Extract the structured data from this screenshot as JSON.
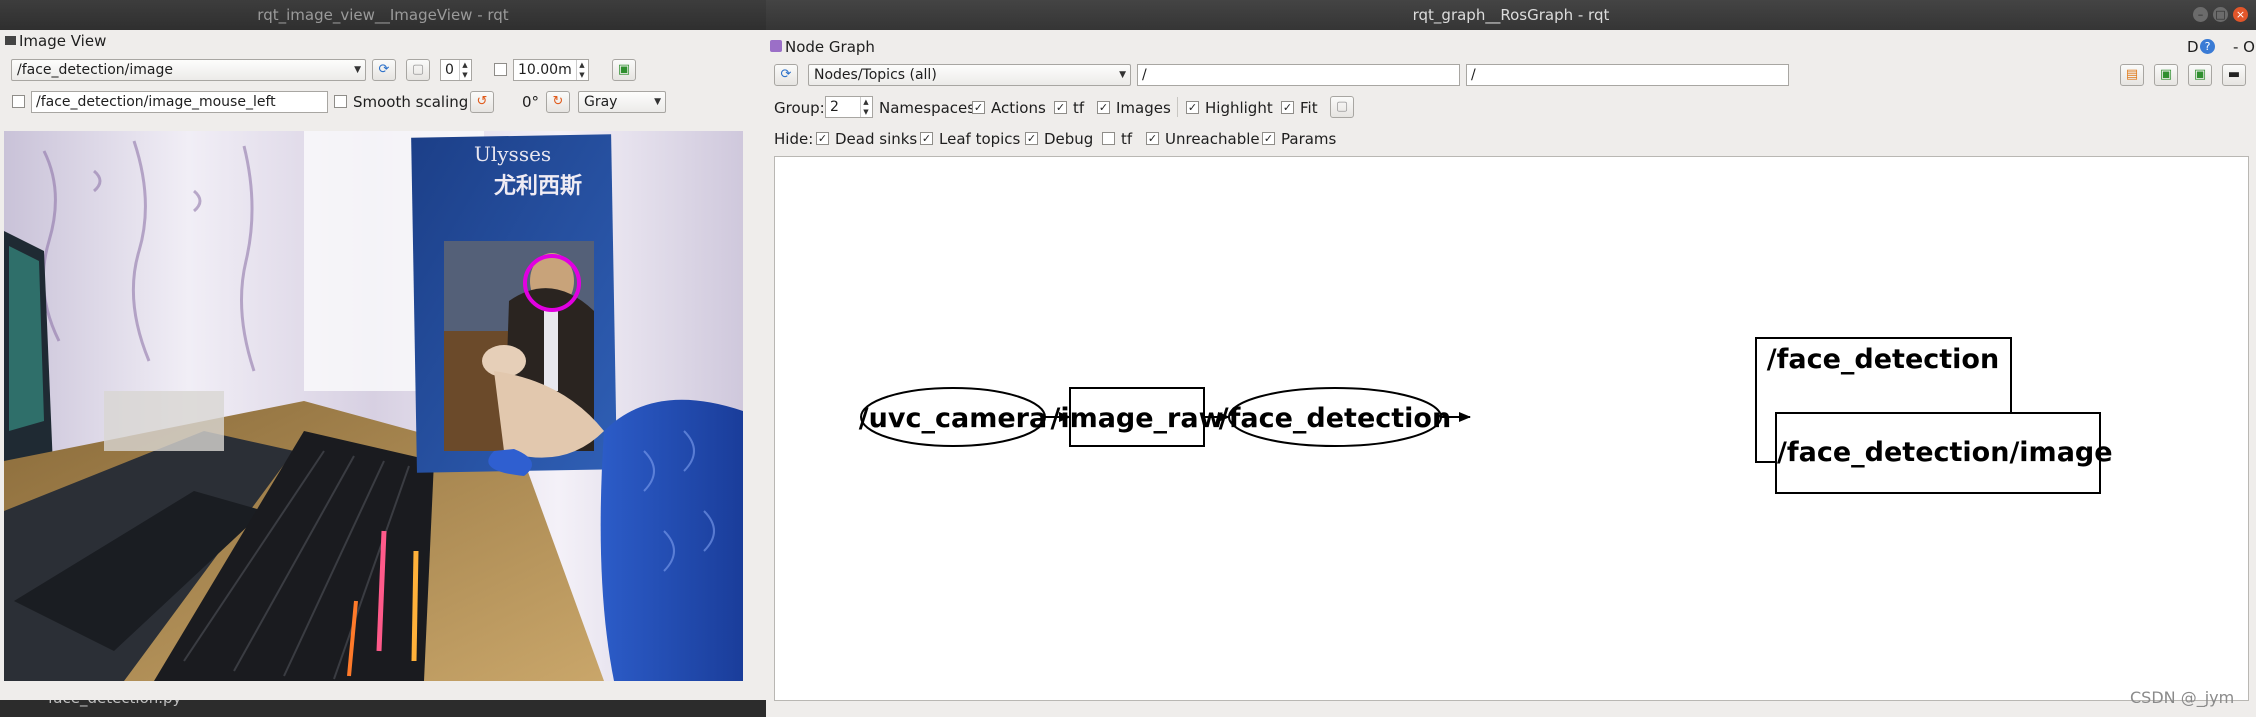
{
  "image_view_window": {
    "title": "rqt_image_view__ImageView - rqt",
    "panel_title": "Image View",
    "topic_value": "/face_detection/image",
    "number_value": "0",
    "distance_value": "10.00m",
    "mouse_topic_value": "/face_detection/image_mouse_left",
    "smooth_scaling_label": "Smooth scaling",
    "rotation_label": "0°",
    "color_scheme_value": "Gray",
    "camera_image_description": "Camera frame with detected face circle"
  },
  "background_terminal": {
    "text": "face_detection.py"
  },
  "rosgraph_window": {
    "title": "rqt_graph__RosGraph - rqt",
    "panel_title": "Node Graph",
    "panel_corner": "D",
    "panel_corner_buttons": "- O",
    "graph_type_value": "Nodes/Topics (all)",
    "filter_1_value": "/",
    "filter_2_value": "/",
    "group_label": "Group:",
    "group_value": "2",
    "namespaces_label": "Namespaces",
    "actions_label": "Actions",
    "tf_label": "tf",
    "images_label": "Images",
    "highlight_label": "Highlight",
    "fit_label": "Fit",
    "hide_label": "Hide:",
    "dead_sinks_label": "Dead sinks",
    "leaf_topics_label": "Leaf topics",
    "debug_label": "Debug",
    "hide_tf_label": "tf",
    "unreachable_label": "Unreachable",
    "params_label": "Params"
  },
  "graph": {
    "nodes": {
      "uvc_camera": "/uvc_camera",
      "image_raw": "/image_raw",
      "face_detection": "/face_detection",
      "namespace_group": "/face_detection",
      "face_detection_image": "/face_detection/image"
    }
  },
  "watermark": "CSDN @_jym",
  "colors": {
    "title_bar": "#353535",
    "window_bg": "#efedeb",
    "close_button": "#e2562a",
    "face_circle": "#e100e1"
  }
}
